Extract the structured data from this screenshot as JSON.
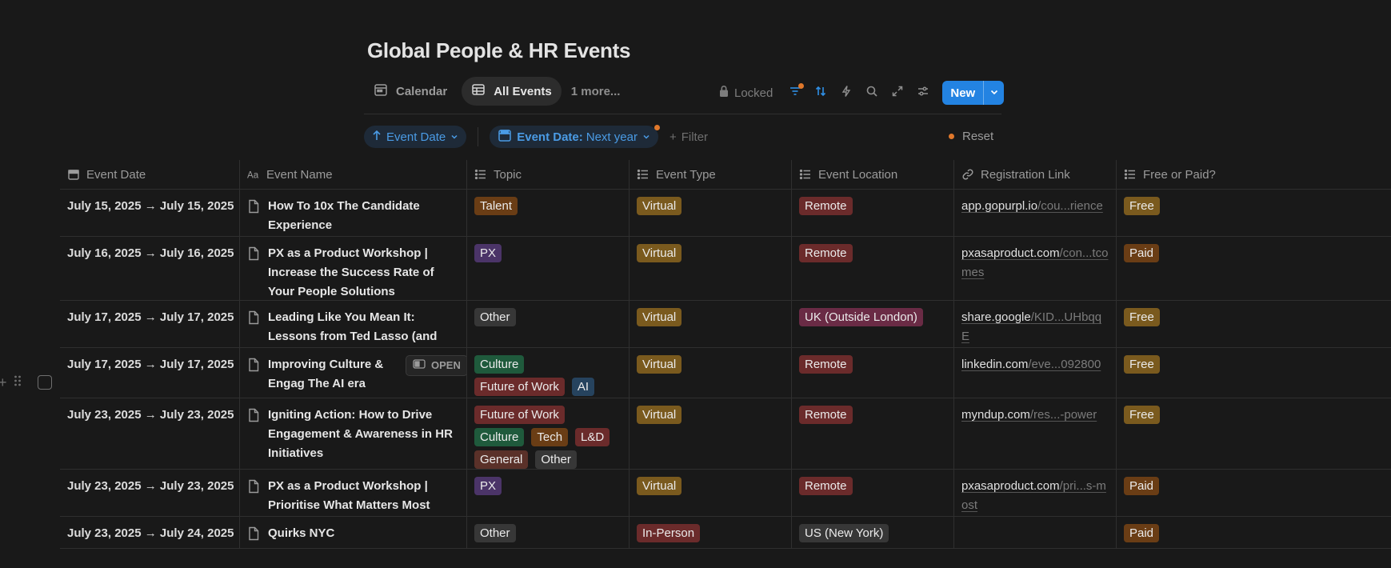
{
  "page": {
    "title": "Global People & HR Events"
  },
  "views": {
    "tabs": [
      {
        "label": "Calendar",
        "icon": "calendar-icon"
      },
      {
        "label": "All Events",
        "icon": "table-icon"
      }
    ],
    "more": "1 more..."
  },
  "toolbar": {
    "locked_label": "Locked",
    "new_label": "New"
  },
  "filters": {
    "sort_label": "Event Date",
    "date_filter_prefix": "Event Date:",
    "date_filter_value": "Next year",
    "add_filter": "Filter",
    "reset": "Reset"
  },
  "columns": [
    {
      "label": "Event Date",
      "icon": "calendar-icon"
    },
    {
      "label": "Event Name",
      "icon": "text-icon"
    },
    {
      "label": "Topic",
      "icon": "list-icon"
    },
    {
      "label": "Event Type",
      "icon": "list-icon"
    },
    {
      "label": "Event Location",
      "icon": "list-icon"
    },
    {
      "label": "Registration Link",
      "icon": "link-icon"
    },
    {
      "label": "Free or Paid?",
      "icon": "list-icon"
    }
  ],
  "open_label": "OPEN",
  "rows": [
    {
      "date": "July 15, 2025 → July 15, 2025",
      "name": "How To 10x The Candidate Experience",
      "topics": [
        "Talent"
      ],
      "type": "Virtual",
      "location": "Remote",
      "link_domain": "app.gopurpl.io",
      "link_rest": "/cou...rience",
      "price": "Free"
    },
    {
      "date": "July 16, 2025 → July 16, 2025",
      "name": "PX as a Product Workshop | Increase the Success Rate of Your People Solutions",
      "topics": [
        "PX"
      ],
      "type": "Virtual",
      "location": "Remote",
      "link_domain": "pxasaproduct.com",
      "link_rest": "/con...tcomes",
      "price": "Paid"
    },
    {
      "date": "July 17, 2025 → July 17, 2025",
      "name": "Leading Like You Mean It: Lessons from Ted Lasso (and real life)",
      "topics": [
        "Other"
      ],
      "type": "Virtual",
      "location": "UK (Outside London)",
      "link_domain": "share.google",
      "link_rest": "/KID...UHbqqE",
      "price": "Free"
    },
    {
      "date": "July 17, 2025 → July 17, 2025",
      "name": "Improving Culture & Engag The AI era",
      "topics": [
        "Culture",
        "Future of Work",
        "AI"
      ],
      "type": "Virtual",
      "location": "Remote",
      "link_domain": "linkedin.com",
      "link_rest": "/eve...092800",
      "price": "Free"
    },
    {
      "date": "July 23, 2025 → July 23, 2025",
      "name": "Igniting Action: How to Drive Engagement & Awareness in HR Initiatives",
      "topics": [
        "Future of Work",
        "Culture",
        "Tech",
        "L&D",
        "General",
        "Other"
      ],
      "type": "Virtual",
      "location": "Remote",
      "link_domain": "myndup.com",
      "link_rest": "/res...-power",
      "price": "Free"
    },
    {
      "date": "July 23, 2025 → July 23, 2025",
      "name": "PX as a Product Workshop | Prioritise What Matters Most",
      "topics": [
        "PX"
      ],
      "type": "Virtual",
      "location": "Remote",
      "link_domain": "pxasaproduct.com",
      "link_rest": "/pri...s-most",
      "price": "Paid"
    },
    {
      "date": "July 23, 2025 → July 24, 2025",
      "name": "Quirks NYC",
      "topics": [
        "Other"
      ],
      "type": "In-Person",
      "location": "US (New York)",
      "link_domain": "",
      "link_rest": "",
      "price": "Paid"
    }
  ],
  "tag_colors": {
    "Talent": "#6a3d15",
    "PX": "#4b3468",
    "Other": "#373737",
    "Culture": "#1f5a3c",
    "Future of Work": "#6b2b2b",
    "AI": "#26435e",
    "Tech": "#6a3d15",
    "L&D": "#6b2b2b",
    "General": "#5a3129",
    "Virtual": "#7a5a1e",
    "In-Person": "#6b2b2b",
    "Remote": "#6b2b2b",
    "UK (Outside London)": "#6a2b45",
    "US (New York)": "#373737",
    "Free": "#7a5a1e",
    "Paid": "#6a3d15"
  }
}
